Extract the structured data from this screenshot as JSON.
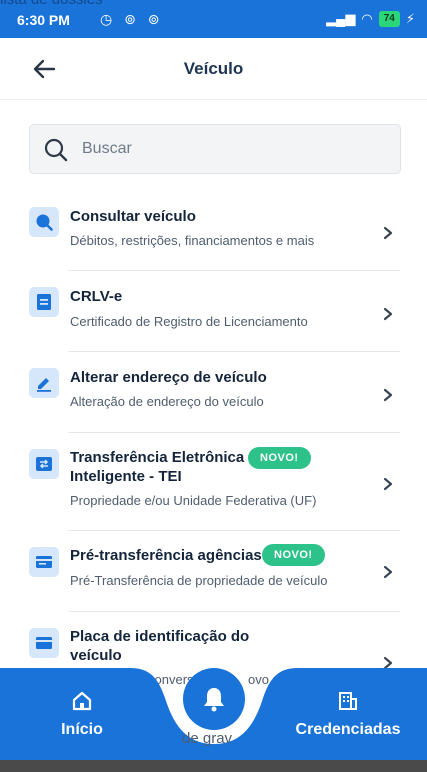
{
  "status": {
    "overlay_text": "lista de dossies",
    "time": "6:30 PM",
    "battery": "74"
  },
  "header": {
    "title": "Veículo"
  },
  "search": {
    "placeholder": "Buscar"
  },
  "items": [
    {
      "title": "Consultar veículo",
      "subtitle": "Débitos, restrições, financiamentos e mais",
      "icon": "search-icon"
    },
    {
      "title": "CRLV-e",
      "subtitle": "Certificado de Registro de Licenciamento",
      "icon": "document-icon"
    },
    {
      "title": "Alterar endereço de veículo",
      "subtitle": "Alteração de endereço do veículo",
      "icon": "edit-icon"
    },
    {
      "title_line1": "Transferência Eletrônica",
      "title_line2": "Inteligente - TEI",
      "subtitle": "Propriedade e/ou Unidade Federativa (UF)",
      "badge": "NOVO!",
      "icon": "transfer-icon"
    },
    {
      "title": "Pré-transferência agências",
      "subtitle": "Pré-Transferência de propriedade de veículo",
      "badge": "NOVO!",
      "icon": "card-icon"
    },
    {
      "title_line1": "Placa de identificação do",
      "title_line2": "veículo",
      "subtitle_partial_left": "",
      "subtitle_partial_mid": "conversã",
      "subtitle_partial_right": "ovo m",
      "below_partial": "de grav",
      "icon": "card-icon"
    }
  ],
  "bottom_nav": {
    "home_label": "Início",
    "accredited_label": "Credenciadas"
  },
  "colors": {
    "primary": "#1a73d8",
    "badge": "#2ec28b",
    "icon_bg": "#d7e7fb"
  }
}
